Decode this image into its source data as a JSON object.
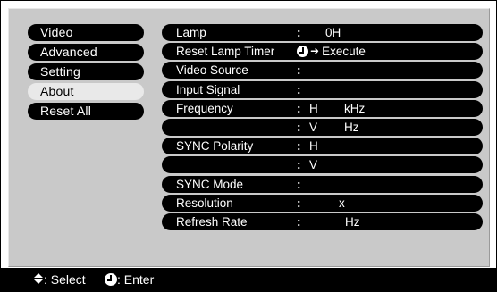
{
  "menu": {
    "items": [
      {
        "label": "Video",
        "selected": false
      },
      {
        "label": "Advanced",
        "selected": false
      },
      {
        "label": "Setting",
        "selected": false
      },
      {
        "label": "About",
        "selected": true
      },
      {
        "label": "Reset All",
        "selected": false
      }
    ]
  },
  "rows": [
    {
      "label": "Lamp",
      "colon": ":",
      "value": "0H"
    },
    {
      "label": "Reset Lamp Timer",
      "colon": "",
      "action": "Execute",
      "icon": "enter-icon"
    },
    {
      "label": "Video Source",
      "colon": ":"
    },
    {
      "label": "Input Signal",
      "colon": ":"
    },
    {
      "label": "Frequency",
      "colon": ":",
      "sub": "H",
      "unit": "kHz"
    },
    {
      "label": "",
      "colon": ":",
      "sub": "V",
      "unit": "Hz"
    },
    {
      "label": "SYNC Polarity",
      "colon": ":",
      "sub": "H"
    },
    {
      "label": "",
      "colon": ":",
      "sub": "V"
    },
    {
      "label": "SYNC Mode",
      "colon": ":"
    },
    {
      "label": "Resolution",
      "colon": ":",
      "value": "x"
    },
    {
      "label": "Refresh Rate",
      "colon": ":",
      "value": "Hz"
    }
  ],
  "footer": {
    "select_label": ": Select",
    "enter_label": ": Enter",
    "select_icon": "up-down-arrow-icon",
    "enter_icon": "enter-icon"
  },
  "colors": {
    "background": "#ffffff",
    "panel": "#c9c9c9",
    "bar": "#000000",
    "selected": "#e9e9e9",
    "text_on_bar": "#ffffff"
  }
}
